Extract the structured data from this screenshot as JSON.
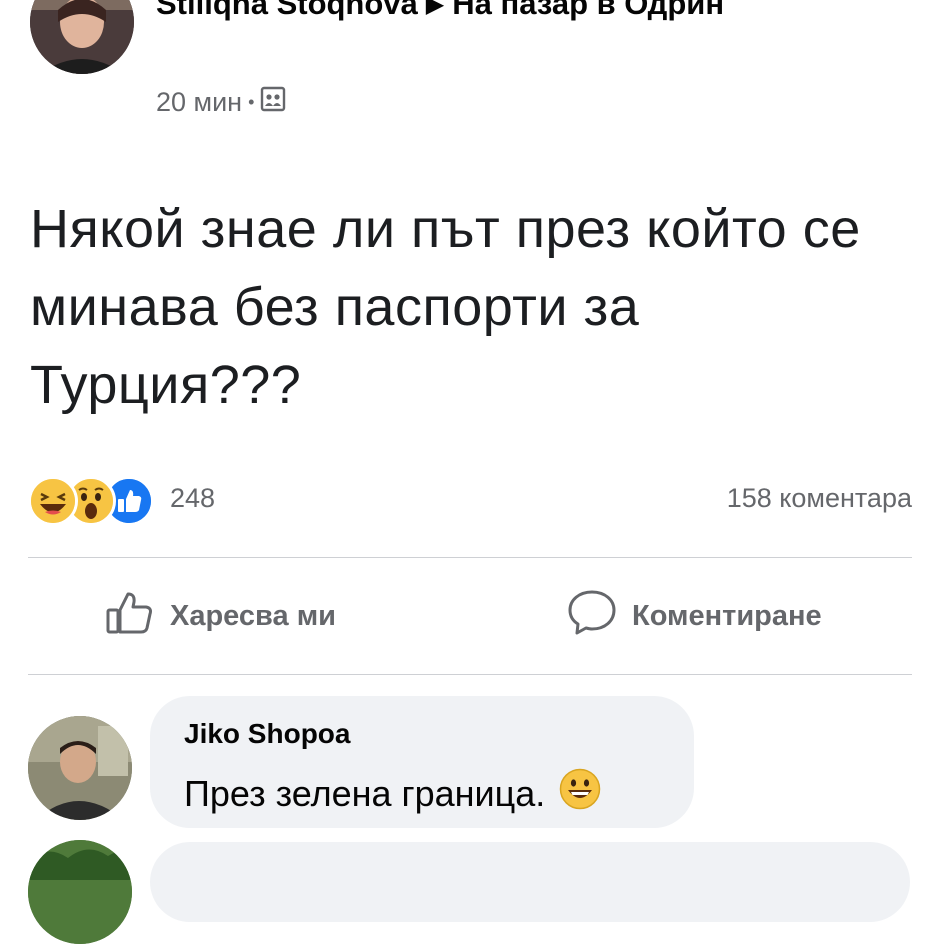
{
  "post": {
    "author": "Stiliqna Stoqnova",
    "group": "На пазар в Одрин",
    "time": "20 мин",
    "privacy_icon": "group-members-icon",
    "text": "Някой знае ли път през който се минава без паспорти за Турция???"
  },
  "reactions": {
    "icons": [
      "laughing-face-icon",
      "wow-face-icon",
      "like-thumb-icon"
    ],
    "count": "248",
    "comments": "158 коментара"
  },
  "actions": {
    "like_label": "Харесва ми",
    "comment_label": "Коментиране"
  },
  "comment": {
    "author": "Jiko Shopoa",
    "text": "През зелена граница.",
    "emoji": "smiley-icon"
  },
  "colors": {
    "like_blue": "#1877f2",
    "reaction_yellow": "#f7c443",
    "secondary_text": "#65676b",
    "bubble_bg": "#f0f2f5"
  }
}
